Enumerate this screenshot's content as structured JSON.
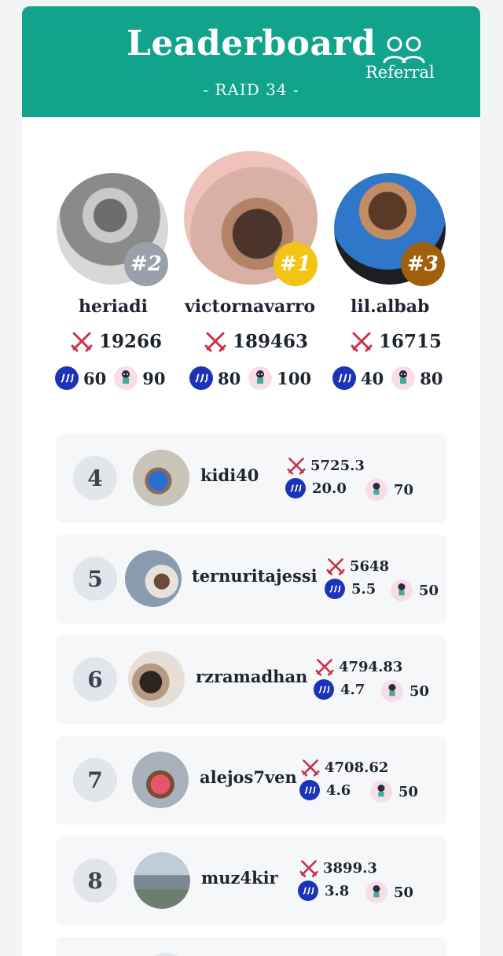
{
  "header": {
    "title": "Leaderboard",
    "referral_label": "Referral",
    "raid_label": "- RAID 34 -",
    "icon": "users-icon",
    "color": "#12a38c"
  },
  "podium": [
    {
      "rank_label": "#2",
      "name": "heriadi",
      "score": "19266",
      "steem": "60",
      "pet": "90",
      "badge_color": "#9aa0aa"
    },
    {
      "rank_label": "#1",
      "name": "victornavarro",
      "score": "189463",
      "steem": "80",
      "pet": "100",
      "badge_color": "#f2c413"
    },
    {
      "rank_label": "#3",
      "name": "lil.albab",
      "score": "16715",
      "steem": "40",
      "pet": "80",
      "badge_color": "#a05f0c"
    }
  ],
  "rows": [
    {
      "rank": "4",
      "name": "kidi40",
      "score": "5725.3",
      "steem": "20.0",
      "pet": "70"
    },
    {
      "rank": "5",
      "name": "ternuritajessi",
      "score": "5648",
      "steem": "5.5",
      "pet": "50"
    },
    {
      "rank": "6",
      "name": "rzramadhan",
      "score": "4794.83",
      "steem": "4.7",
      "pet": "50"
    },
    {
      "rank": "7",
      "name": "alejos7ven",
      "score": "4708.62",
      "steem": "4.6",
      "pet": "50"
    },
    {
      "rank": "8",
      "name": "muz4kir",
      "score": "3899.3",
      "steem": "3.8",
      "pet": "50"
    }
  ],
  "icons": {
    "score": "crossed-swords-icon",
    "steem": "steem-icon",
    "pet": "pet-icon"
  }
}
